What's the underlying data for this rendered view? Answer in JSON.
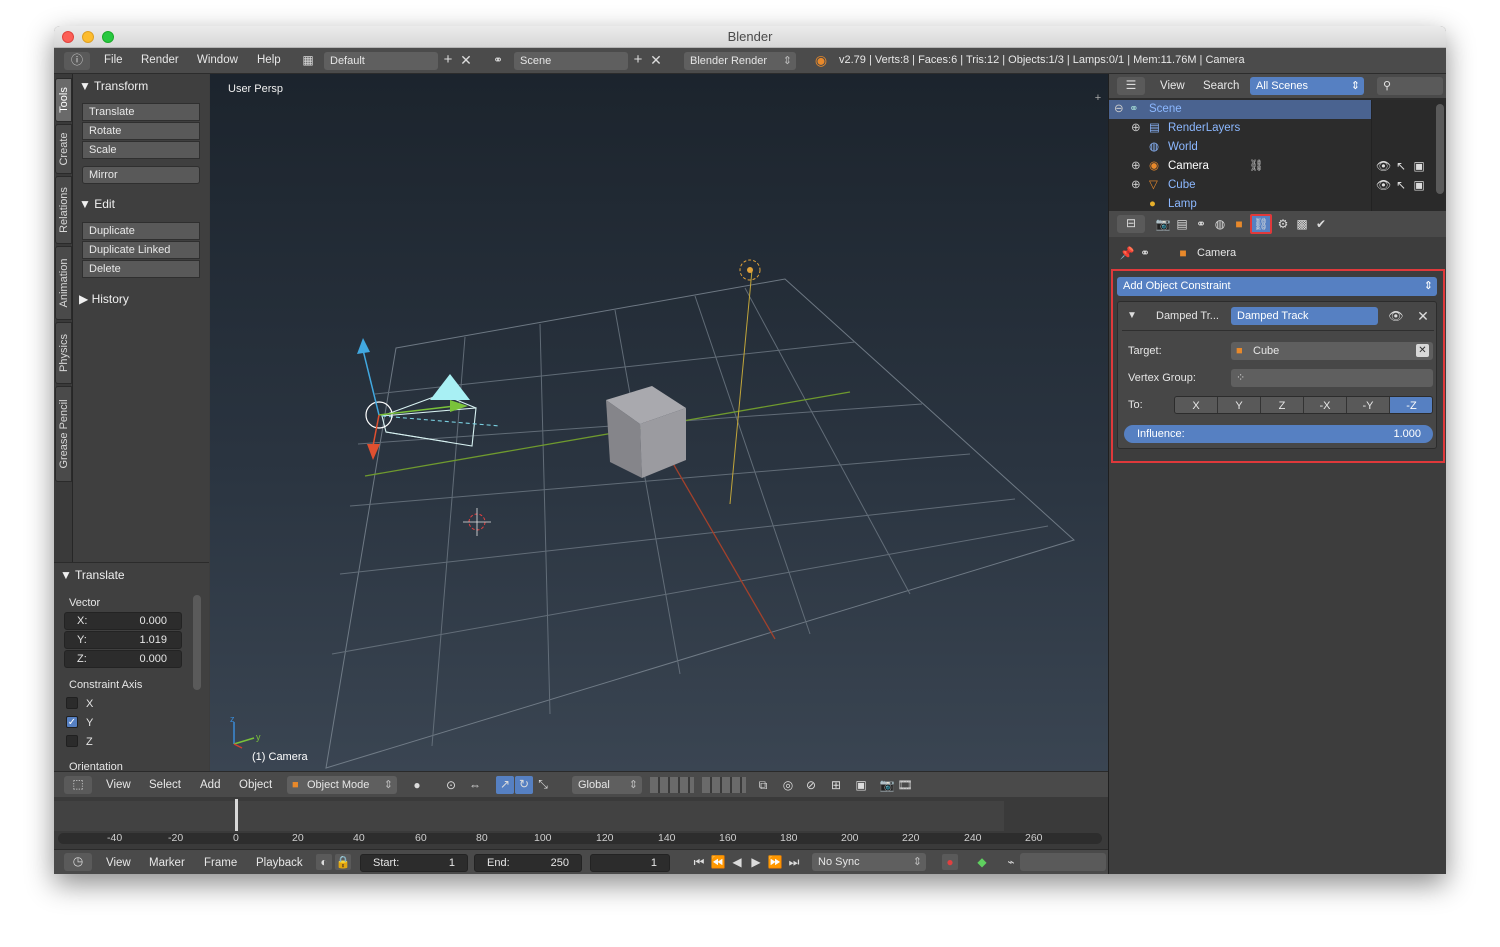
{
  "window": {
    "title": "Blender"
  },
  "topbar": {
    "menus": [
      "File",
      "Render",
      "Window",
      "Help"
    ],
    "layout": "Default",
    "scene": "Scene",
    "engine": "Blender Render",
    "stats": "v2.79 | Verts:8 | Faces:6 | Tris:12 | Objects:1/3 | Lamps:0/1 | Mem:11.76M | Camera"
  },
  "tool_tabs": [
    "Tools",
    "Create",
    "Relations",
    "Animation",
    "Physics",
    "Grease Pencil"
  ],
  "toolshelf": {
    "transform": {
      "title": "Transform",
      "buttons": [
        "Translate",
        "Rotate",
        "Scale",
        "Mirror"
      ]
    },
    "edit": {
      "title": "Edit",
      "buttons": [
        "Duplicate",
        "Duplicate Linked",
        "Delete"
      ]
    },
    "history": {
      "title": "History"
    }
  },
  "operator": {
    "title": "Translate",
    "vector_label": "Vector",
    "x": {
      "label": "X:",
      "value": "0.000"
    },
    "y": {
      "label": "Y:",
      "value": "1.019"
    },
    "z": {
      "label": "Z:",
      "value": "0.000"
    },
    "constraint_axis_label": "Constraint Axis",
    "axes": [
      {
        "label": "X",
        "checked": false
      },
      {
        "label": "Y",
        "checked": true
      },
      {
        "label": "Z",
        "checked": false
      }
    ],
    "orientation_label": "Orientation"
  },
  "viewport": {
    "view_name": "User Persp",
    "object_label": "(1) Camera",
    "axis_z": "z",
    "axis_y": "y"
  },
  "view3d_header": {
    "menus": [
      "View",
      "Select",
      "Add",
      "Object"
    ],
    "mode": "Object Mode",
    "orientation": "Global"
  },
  "timeline": {
    "ticks": [
      "-40",
      "-20",
      "0",
      "20",
      "40",
      "60",
      "80",
      "100",
      "120",
      "140",
      "160",
      "180",
      "200",
      "220",
      "240",
      "260"
    ],
    "current_frame_marker": 0
  },
  "timeline_header": {
    "menus": [
      "View",
      "Marker",
      "Frame",
      "Playback"
    ],
    "start_label": "Start:",
    "start": "1",
    "end_label": "End:",
    "end": "250",
    "current": "1",
    "sync": "No Sync"
  },
  "outliner": {
    "menus": [
      "View",
      "Search"
    ],
    "filter": "All Scenes",
    "items": [
      {
        "name": "Scene",
        "selected": true
      },
      {
        "name": "RenderLayers"
      },
      {
        "name": "World"
      },
      {
        "name": "Camera"
      },
      {
        "name": "Cube"
      },
      {
        "name": "Lamp"
      }
    ]
  },
  "properties": {
    "breadcrumb": "Camera",
    "add_constraint": "Add Object Constraint",
    "constraint": {
      "short_name": "Damped Tr...",
      "name": "Damped Track",
      "target_label": "Target:",
      "target": "Cube",
      "vertex_group_label": "Vertex Group:",
      "vertex_group": "",
      "to_label": "To:",
      "axes": [
        "X",
        "Y",
        "Z",
        "-X",
        "-Y",
        "-Z"
      ],
      "active_axis": "-Z",
      "influence_label": "Influence:",
      "influence_value": "1.000",
      "influence": 1.0
    }
  },
  "colors": {
    "highlight": "#e0393b",
    "selection": "#5680c2",
    "grid_x": "#a3412b",
    "grid_y": "#6f9a2e"
  }
}
